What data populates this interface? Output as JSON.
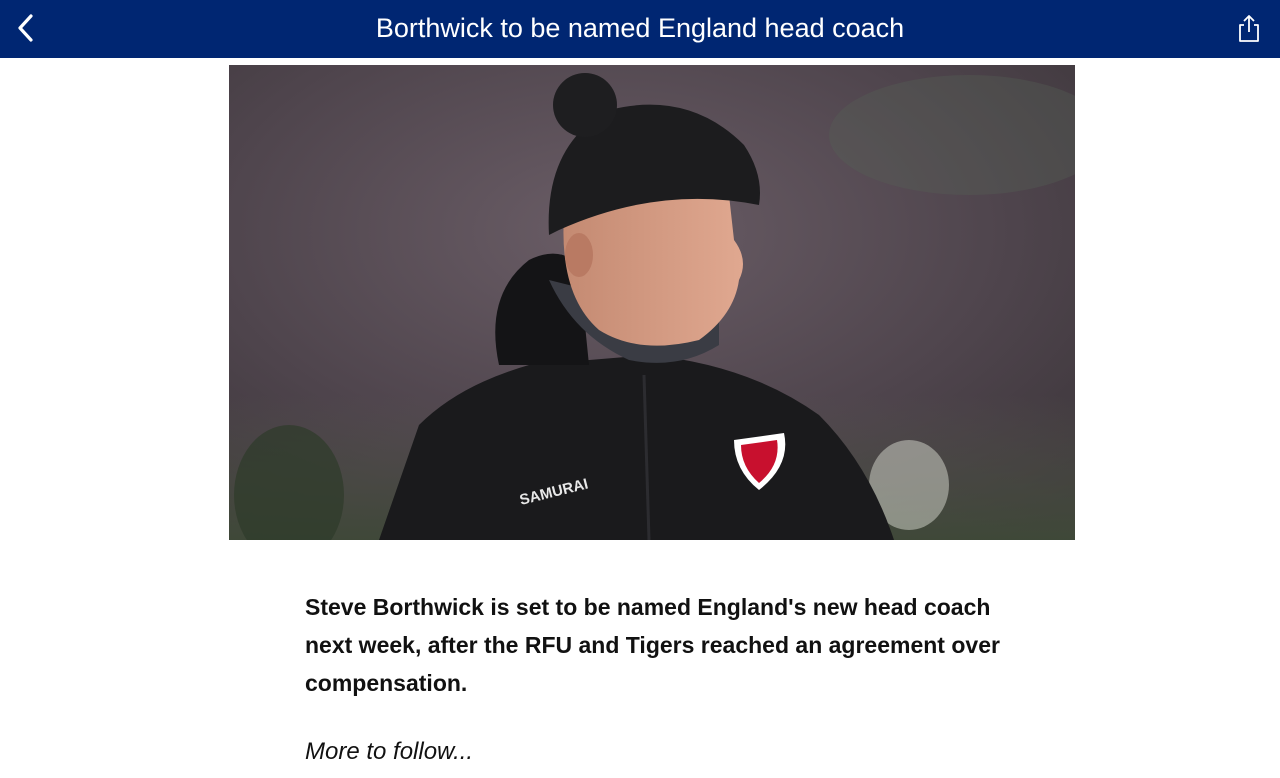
{
  "header": {
    "title": "Borthwick to be named England head coach",
    "back_icon": "chevron-left-icon",
    "share_icon": "share-icon",
    "background_color": "#002672"
  },
  "hero_image": {
    "subject": "coach in black beanie and black jacket on training ground",
    "jacket_text": "SAMURAI"
  },
  "article": {
    "lead": "Steve Borthwick is set to be named England's new head coach next week, after the RFU and Tigers reached an agreement over compensation.",
    "more": "More to follow..."
  }
}
